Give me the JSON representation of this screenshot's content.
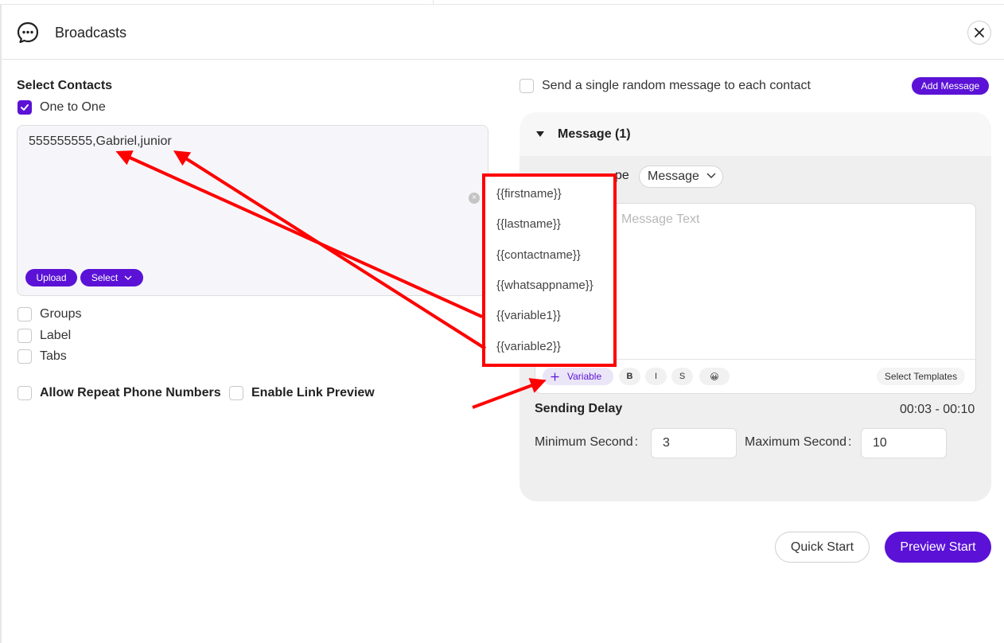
{
  "header": {
    "title": "Broadcasts",
    "icon": "chat-bubble-icon"
  },
  "contacts": {
    "section_title": "Select Contacts",
    "one_to_one": {
      "label": "One to One",
      "checked": true
    },
    "textarea_value": "555555555,Gabriel,junior",
    "upload_label": "Upload",
    "select_label": "Select",
    "groups_label": "Groups",
    "label_label": "Label",
    "tabs_label": "Tabs",
    "allow_repeat_label": "Allow Repeat Phone Numbers",
    "enable_link_preview_label": "Enable Link Preview"
  },
  "message": {
    "random_message_label": "Send a single random message to each contact",
    "add_message_label": "Add Message",
    "panel_title": "Message (1)",
    "type_label_visible": "pe",
    "type_value": "Message",
    "placeholder_visible": "Message Text",
    "variable_label": "Variable",
    "format_bold": "B",
    "format_italic": "I",
    "format_strike": "S",
    "emoji": "😀",
    "select_templates_label": "Select Templates"
  },
  "variables": [
    "{{firstname}}",
    "{{lastname}}",
    "{{contactname}}",
    "{{whatsappname}}",
    "{{variable1}}",
    "{{variable2}}"
  ],
  "delay": {
    "title": "Sending Delay",
    "range": "00:03 - 00:10",
    "min_label": "Minimum Second",
    "min_value": "3",
    "max_label": "Maximum Second",
    "max_value": "10",
    "colon": ":"
  },
  "actions": {
    "quick_start": "Quick Start",
    "preview_start": "Preview Start"
  },
  "colors": {
    "accent": "#5b12d6",
    "annotation": "#ff0000"
  }
}
